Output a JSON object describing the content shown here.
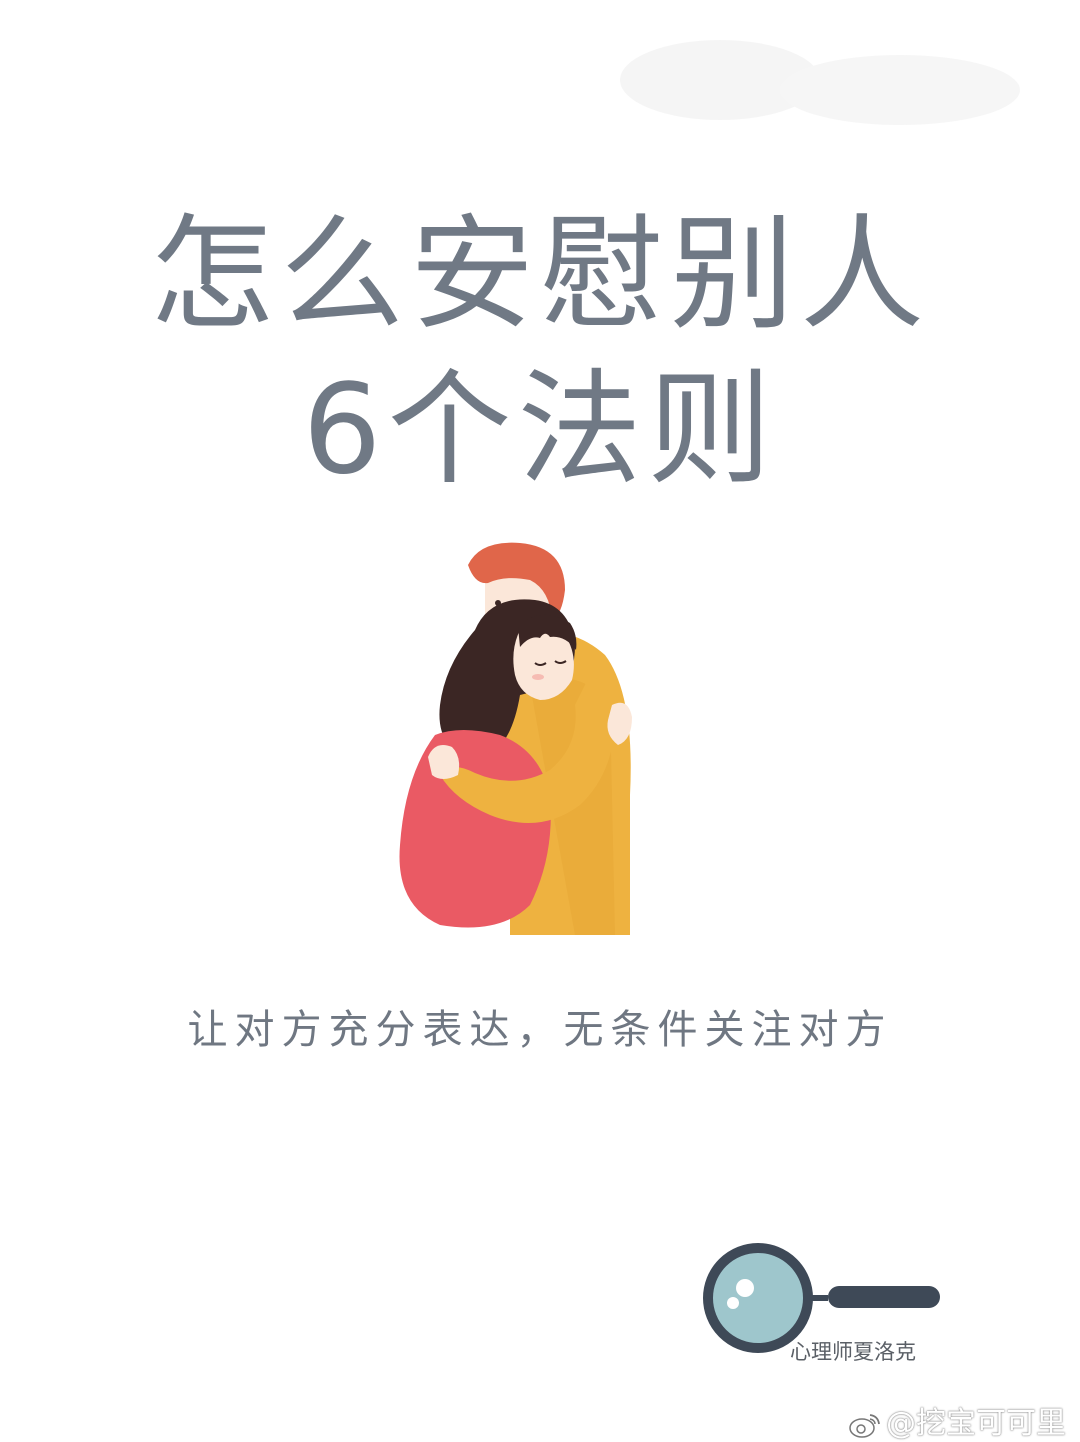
{
  "title": {
    "line1": "怎么安慰别人",
    "line2": "6个法则"
  },
  "subtitle": "让对方充分表达，无条件关注对方",
  "logo": {
    "label": "心理师夏洛克",
    "icon": "magnifying-glass-icon"
  },
  "watermark": {
    "text": "@挖宝可可里",
    "icon": "weibo-icon"
  },
  "illustration": {
    "subject": "hugging-couple",
    "colors": {
      "man_hair": "#e0664a",
      "man_coat": "#eeb240",
      "woman_hair": "#3b2624",
      "woman_dress": "#ea5a64",
      "skin": "#fbe7d9"
    }
  },
  "colors": {
    "title": "#707985",
    "subtitle": "#6f7782",
    "lens": "#9ec6cc",
    "handle": "#3e4957"
  }
}
